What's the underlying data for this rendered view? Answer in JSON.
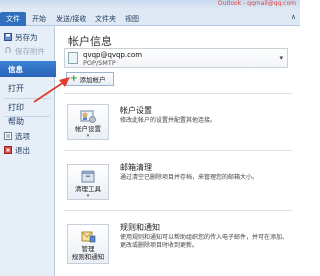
{
  "window": {
    "title": "Outlook - qqmail@qq.com"
  },
  "ribbon": {
    "tabs": [
      "文件",
      "开始",
      "发送/接收",
      "文件夹",
      "视图"
    ],
    "minimize_glyph": "∧"
  },
  "nav": {
    "save_as": "另存为",
    "save_attachments": "保存附件",
    "info": "信息",
    "open": "打开",
    "print": "打印",
    "help": "帮助",
    "options": "选项",
    "exit": "退出"
  },
  "main": {
    "heading": "帐户信息",
    "account": {
      "email": "qvqp@qvqp.com",
      "type": "POP/SMTP",
      "dropdown_glyph": "▾"
    },
    "add_account": {
      "plus_glyph": "+",
      "label": "添加帐户"
    },
    "sections": [
      {
        "tile_label": "帐户设置",
        "tile_caret": "▾",
        "title": "帐户设置",
        "description": "修改此帐户的设置并配置其他连接。"
      },
      {
        "tile_label": "清理工具",
        "tile_caret": "▾",
        "title": "邮箱清理",
        "description": "通过清空已删除项目并存档，来管理您的邮箱大小。"
      },
      {
        "tile_label": "管理\n规则和通知",
        "tile_caret": "",
        "title": "规则和通知",
        "description": "使用规则和通知可以帮助组织您的传入电子邮件，并可在添加、更改或删除项目时收到更新。"
      }
    ]
  },
  "colors": {
    "accent": "#2f6fbe",
    "arrow": "#e53b2f",
    "add_icon": "#2a9d2a"
  }
}
